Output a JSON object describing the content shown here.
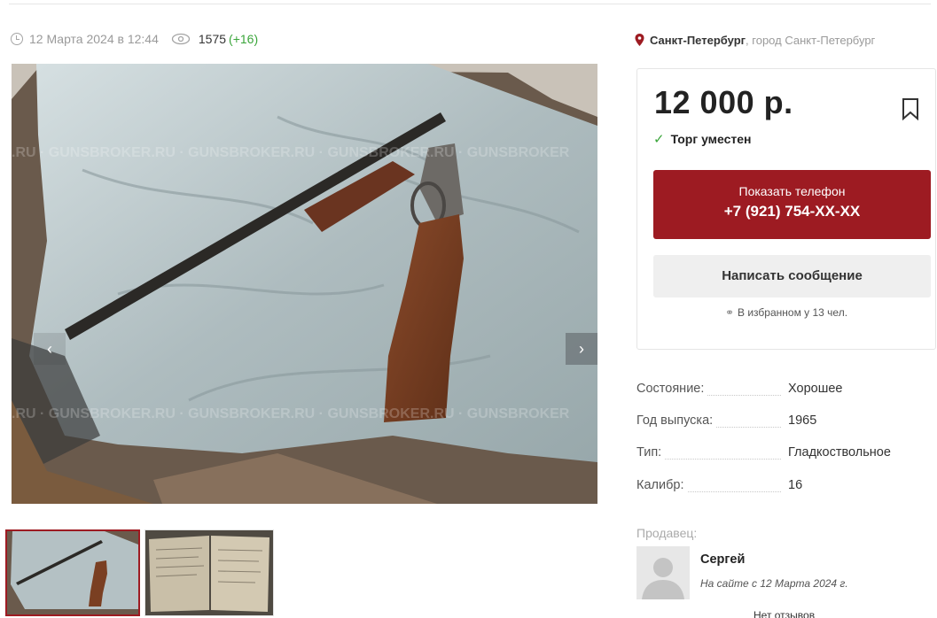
{
  "meta": {
    "date": "12 Марта 2024 в 12:44",
    "views": "1575",
    "views_delta": "(+16)"
  },
  "location": {
    "city": "Санкт-Петербург",
    "rest": ", город Санкт-Петербург"
  },
  "gallery": {
    "watermark": "GUNSBROKER.RU",
    "prev_label": "‹",
    "next_label": "›"
  },
  "listing": {
    "price": "12 000 р.",
    "bargain": "Торг уместен",
    "phone_label": "Показать телефон",
    "phone_number": "+7 (921) 754-XX-XX",
    "message_label": "Написать сообщение",
    "favorites": "В избранном у 13 чел."
  },
  "specs": [
    {
      "label": "Состояние:",
      "value": "Хорошее"
    },
    {
      "label": "Год выпуска:",
      "value": "1965"
    },
    {
      "label": "Тип:",
      "value": "Гладкоствольное"
    },
    {
      "label": "Калибр:",
      "value": "16"
    }
  ],
  "seller": {
    "heading": "Продавец:",
    "name": "Сергей",
    "since": "На сайте с 12 Марта 2024 г.",
    "reviews": "Нет отзывов"
  },
  "colors": {
    "accent": "#9d1b22",
    "positive": "#3aa53a"
  },
  "icons": {
    "time": "clock-icon",
    "views": "eye-icon",
    "location": "map-pin-icon",
    "favorite": "bookmark-icon",
    "bargain": "check-icon",
    "fullscreen": "fullscreen-icon",
    "favorites_count": "binoculars-icon"
  }
}
